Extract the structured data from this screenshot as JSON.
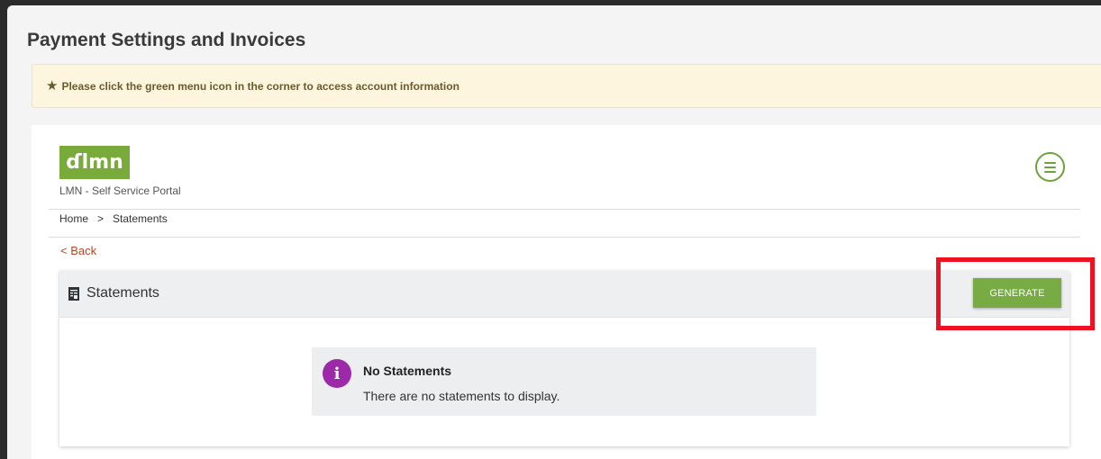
{
  "page": {
    "title": "Payment Settings and Invoices",
    "notice": "Please click the green menu icon in the corner to access account information"
  },
  "portal": {
    "logo_text": "ɗlmn",
    "name": "LMN - Self Service Portal"
  },
  "breadcrumb": {
    "home": "Home",
    "separator": ">",
    "current": "Statements"
  },
  "nav": {
    "back_label": "< Back"
  },
  "statements": {
    "title": "Statements",
    "generate_label": "GENERATE",
    "empty_title": "No Statements",
    "empty_message": "There are no statements to display."
  },
  "colors": {
    "brand_green": "#79ab3a",
    "menu_icon_green": "#6aa33b",
    "info_purple": "#9c2aa8",
    "highlight_red": "#ee1122"
  },
  "icons": {
    "notice": "star-icon",
    "menu": "hamburger-menu-icon",
    "card": "document-icon",
    "info": "info-icon"
  }
}
